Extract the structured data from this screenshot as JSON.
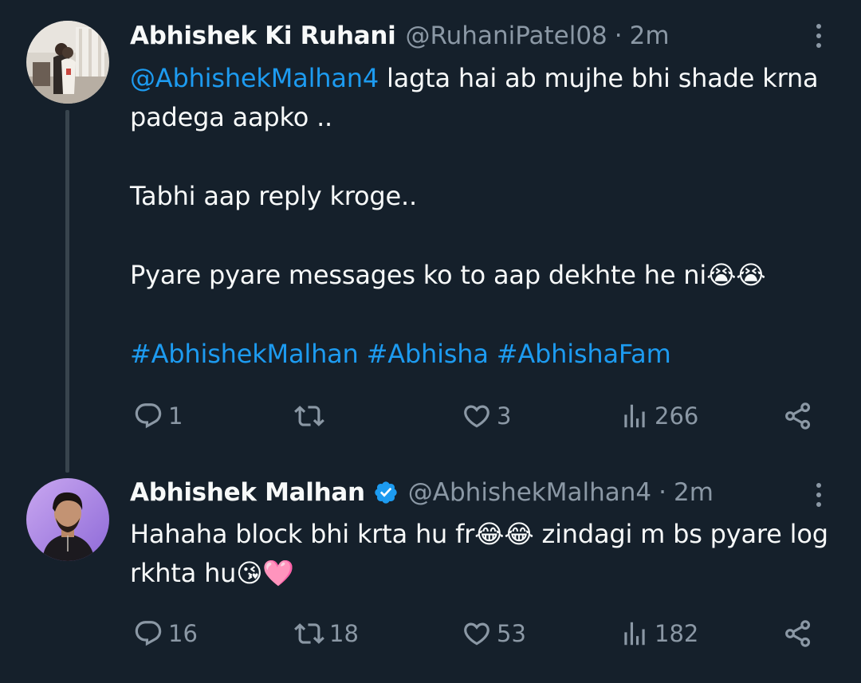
{
  "tweets": [
    {
      "author": {
        "name": "Abhishek Ki Ruhani",
        "handle": "@RuhaniPatel08",
        "time": "2m",
        "verified": false,
        "avatar_icon": "profile-photo-couple"
      },
      "body": {
        "line1_mention": "@AbhishekMalhan4",
        "line1_text": " lagta hai ab mujhe bhi shade krna padega aapko ..",
        "line2": "Tabhi aap reply kroge..",
        "line3_text": "Pyare pyare messages ko to aap dekhte he ni",
        "line3_emoji": "😭😭",
        "hashtags": "#AbhishekMalhan #Abhisha #AbhishaFam"
      },
      "stats": {
        "replies": "1",
        "reposts": "",
        "likes": "3",
        "views": "266"
      }
    },
    {
      "author": {
        "name": "Abhishek Malhan",
        "handle": "@AbhishekMalhan4",
        "time": "2m",
        "verified": true,
        "avatar_icon": "profile-photo-man"
      },
      "body": {
        "text1": "Hahaha block bhi krta hu fr",
        "emoji1": "😂😂",
        "text2": " zindagi m bs pyare log rkhta hu",
        "emoji2": "😘🩷"
      },
      "stats": {
        "replies": "16",
        "reposts": "18",
        "likes": "53",
        "views": "182"
      }
    }
  ],
  "separator": "·",
  "colors": {
    "background": "#15202b",
    "text": "#f7f9f9",
    "muted": "#8b98a5",
    "link": "#1d9bf0",
    "verified": "#1d9bf0",
    "thread_line": "#38444d"
  }
}
